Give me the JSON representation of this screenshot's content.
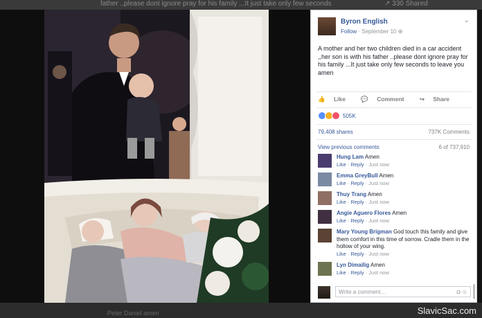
{
  "background": {
    "top_text_left": "father ..please dont ignore pray for his family ...It just take only few seconds",
    "top_text_right": "↗ 330 Shared",
    "bottom_faint": "Peter Daniel amen"
  },
  "photo": {
    "description_label": "Family portrait photo"
  },
  "post": {
    "author": "Byron English",
    "follow": "Follow",
    "date": "September 10",
    "globe_icon": "globe-icon",
    "text": "A mother and her two children died in a car accident ,,her son is with his father ..please dont ignore pray for his family ...It just take only few seconds to leave you amen",
    "actions": {
      "like": "Like",
      "comment": "Comment",
      "share": "Share"
    },
    "reactions_count": "505K",
    "shares": "79,408 shares",
    "comments_total": "737K Comments",
    "view_previous": "View previous comments",
    "comments_counter": "6 of 737,910"
  },
  "comments": [
    {
      "name": "Hung Lam",
      "text": "Amen",
      "like": "Like",
      "reply": "Reply",
      "time": "Just now",
      "color": "#4a3c6e"
    },
    {
      "name": "Emma GreyBull",
      "text": "Amen",
      "like": "Like",
      "reply": "Reply",
      "time": "Just now",
      "color": "#7b8aa3"
    },
    {
      "name": "Thuy Trang",
      "text": "Amen",
      "like": "Like",
      "reply": "Reply",
      "time": "Just now",
      "color": "#8f6f63"
    },
    {
      "name": "Angie Aguero Flores",
      "text": "Amen",
      "like": "Like",
      "reply": "Reply",
      "time": "Just now",
      "color": "#3f2f40"
    },
    {
      "name": "Mary Young Brigman",
      "text": "God touch this family and give them comfort in this time of sorrow. Cradle them in the hollow of your wing.",
      "like": "Like",
      "reply": "Reply",
      "time": "Just now",
      "color": "#5a4334"
    },
    {
      "name": "Lyn Dimailig",
      "text": "Amen",
      "like": "Like",
      "reply": "Reply",
      "time": "Just now",
      "color": "#6b7350"
    }
  ],
  "write_comment": {
    "placeholder": "Write a comment...",
    "camera_icon": "camera-icon",
    "emoji_icon": "smile-icon"
  },
  "watermark": "SlavicSac.com"
}
